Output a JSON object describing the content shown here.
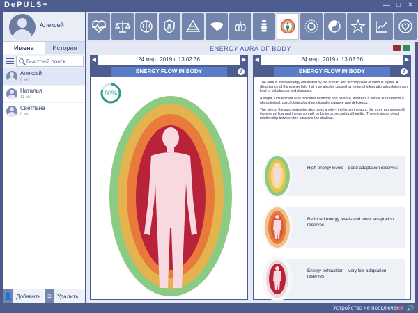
{
  "app": {
    "title": "DePULS+"
  },
  "window": {
    "minimize": "—",
    "maximize": "□",
    "close": "✕"
  },
  "user": {
    "name": "Алексей"
  },
  "toolbar": {
    "icons": [
      "heart-pulse-icon",
      "scales-icon",
      "brain-icon",
      "shield-icon",
      "pyramid-icon",
      "liver-icon",
      "lungs-icon",
      "spine-icon",
      "aura-icon",
      "sun-chakra-icon",
      "yin-yang-icon",
      "star-icon",
      "chart-icon",
      "heart-ring-icon"
    ],
    "active_index": 8
  },
  "sidebar": {
    "tabs": [
      "Имена",
      "История"
    ],
    "active_tab": 0,
    "search_placeholder": "Быстрый поиск",
    "patients": [
      {
        "name": "Алексей",
        "info": "0 мкг"
      },
      {
        "name": "Наталья",
        "info": "11 мкг"
      },
      {
        "name": "Светлана",
        "info": "0 мкг"
      }
    ],
    "add_label": "Добавить",
    "delete_label": "Удалить"
  },
  "main": {
    "title": "ENERGY AURA OF BODY",
    "left": {
      "date": "24 март 2019 г. 13:02:36",
      "panel_title": "ENERGY FLOW IN BODY",
      "percent": "80%",
      "percent_value": 0.8
    },
    "right": {
      "date": "24 март 2019 г. 13:02:36",
      "panel_title": "ENERGY FLOW IN BODY",
      "paragraphs": [
        "The aura is the bioenergy emanated by the human and is composed of various layers. A disturbance of the energy field that may also be caused by external informational pollution can lead to imbalances and diseases.",
        "A bright, luminescent aura indicates harmony and balance, whereas a darker aura reflects a physiological, psychological and emotional imbalance and deficiency.",
        "The size of the aura perimeter also plays a role – the larger the aura, the more pronounced if the energy flow and the person will be better protected and healthy. There is also a direct relationship between the aura and the chakras."
      ],
      "legend": [
        {
          "text": "High energy levels – good adaptation reserves"
        },
        {
          "text": "Reduced energy levels and lower adaptation reserves"
        },
        {
          "text": "Energy exhaustion – very low adaptation reserves"
        }
      ]
    }
  },
  "status": {
    "text": "Устройство не подключено"
  },
  "colors": {
    "accent": "#4d5d90",
    "title_blue": "#5b7cc6",
    "aura_green": "#7cc27a",
    "aura_orange": "#f0a24a",
    "aura_red": "#b8233a",
    "body": "#f7d9df"
  }
}
